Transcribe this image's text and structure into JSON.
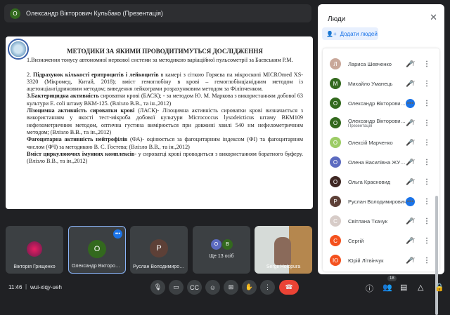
{
  "topbar": {
    "avatar": "О",
    "presenter": "Олександр Вікторович Кульбако (Презентація)"
  },
  "slide": {
    "title": "МЕТОДИКИ ЗА ЯКИМИ ПРОВОДИТИМУТЬСЯ ДОСЛІДЖЕННЯ",
    "p1": "1.Визначення тонусу автономної нервової системи за методикою  варіаційної пульсометрії за Баєвським Р.М.",
    "p2_bold": "Підрахунок кількості еритроцитів і лейкоцитів",
    "p2_pre": "2. ",
    "p2_rest": " в камері з сіткою Горяєва па мікроскопі MICROmed XS-3320 (Мікромед, Китай, 2018);  вміст  гемоглобіну в крові – гемоглобінціанідним методом із ацетонціангідриновим методом; виведення лейкограми розрахунковим методом за Філіпченком.",
    "p3_bold": "3.Бактерицидна активність",
    "p3_rest": "  сироватки крові (БАСК); - за методом Ю. М. Маркова  з використанням добової 63 культури E. coli штаму ВКМ-125. (Влізло В.В., та ін.,2012)",
    "p4_bold": "Лізоцимна активність сироватки крові",
    "p4_rest": " (ЛАСК)- Лізоцимна активність сироватки крові визначається з використанням у якості тест-мікроба добової культури Micrococcus lysodeicticus штаму ВКМ109 нефелометричним методом, оптична густина вимірюється при довжині хвилі 540 нм нефелометричним  методом; (Влізло В.В., та ін.,2012)",
    "p5_bold": "Фагоцитарна активність нейтрофілів",
    "p5_rest": " (ФА)-  оцінюється за фагоцитарним індексом (ФІ) та фагоцитарним числом (ФЧ) за методикою В. С. Гостева; (Влізло В.В., та ін.,2012)",
    "p6_bold": "Вміст циркулюючих імунних комплексів",
    "p6_rest": "- у сироватці крові проводиться з використанням боратного буферу. (Влізло В.В., та ін.,2012)"
  },
  "panel": {
    "title": "Люди",
    "close": "✕",
    "add_people": "Додати людей",
    "people": [
      {
        "initial": "Л",
        "name": "Лариса Шевченко",
        "color": "#c9a89a",
        "status": "muted"
      },
      {
        "initial": "М",
        "name": "Михайло Уманець",
        "color": "#33691e",
        "status": "muted"
      },
      {
        "initial": "О",
        "name": "Олександр Вікторович Кульбако",
        "color": "#33691e",
        "status": "speaking"
      },
      {
        "initial": "О",
        "name": "Олександр Вікторович Кульбако",
        "sub": "Презентація",
        "color": "#33691e",
        "status": "muted"
      },
      {
        "initial": "О",
        "name": "Олексій Марченко",
        "color": "#9ccc65",
        "status": "muted"
      },
      {
        "initial": "О",
        "name": "Олена Василівна ЖУРЕНКО",
        "color": "#5c6bc0",
        "status": "muted"
      },
      {
        "initial": "О",
        "name": "Ольга Красновид",
        "color": "#3e2723",
        "status": "muted"
      },
      {
        "initial": "Р",
        "name": "Руслан Володимирович",
        "color": "#5d4037",
        "status": "speaking"
      },
      {
        "initial": "С",
        "name": "Світлана Ткачук",
        "color": "#d7ccc8",
        "status": "muted"
      },
      {
        "initial": "С",
        "name": "Сергій",
        "color": "#f4511e",
        "status": "muted"
      },
      {
        "initial": "Ю",
        "name": "Юрій Літвінчук",
        "color": "#f4511e",
        "status": "muted"
      }
    ]
  },
  "tiles": [
    {
      "name": "Вікторія Грищенко"
    },
    {
      "name": "Олександр Вікторович",
      "initial": "О"
    },
    {
      "name": "Руслан Володимирович",
      "initial": "Р"
    },
    {
      "name": "Ще 13 осіб",
      "a": "О",
      "b": "В"
    },
    {
      "name": "Sergii Holopura"
    }
  ],
  "bottom": {
    "time": "11:46",
    "code": "wui-xiqy-ueh",
    "people_count": "18"
  }
}
